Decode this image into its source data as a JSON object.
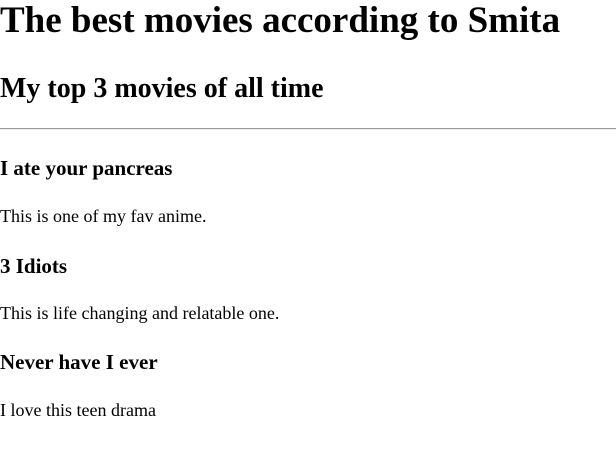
{
  "page": {
    "title": "The best movies according to Smita",
    "subtitle": "My top 3 movies of all time"
  },
  "movies": [
    {
      "title": "I ate your pancreas",
      "description": "This is one of my fav anime."
    },
    {
      "title": "3 Idiots",
      "description": "This is life changing and relatable one."
    },
    {
      "title": "Never have I ever",
      "description": "I love this teen drama"
    }
  ]
}
